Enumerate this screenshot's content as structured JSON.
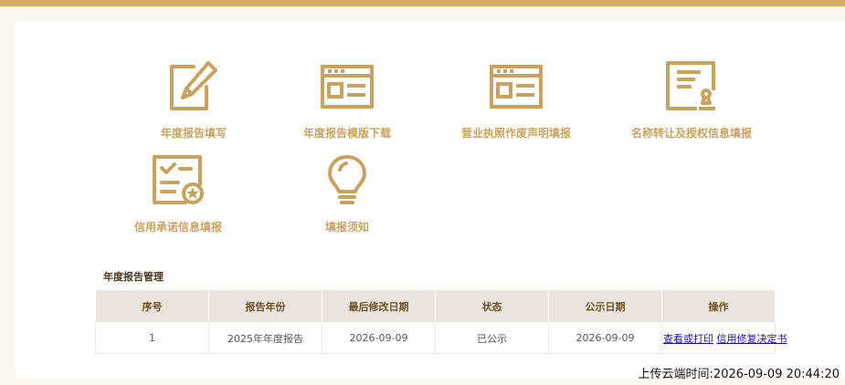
{
  "menu": [
    {
      "label": "年度报告填写",
      "icon": "edit-icon"
    },
    {
      "label": "年度报告模版下载",
      "icon": "template-icon"
    },
    {
      "label": "营业执照作废声明填报",
      "icon": "license-icon"
    },
    {
      "label": "名称转让及授权信息填报",
      "icon": "stamp-document-icon"
    },
    {
      "label": "信用承诺信息填报",
      "icon": "checklist-badge-icon"
    },
    {
      "label": "填报须知",
      "icon": "lightbulb-icon"
    }
  ],
  "section_title": "年度报告管理",
  "table": {
    "headers": [
      "序号",
      "报告年份",
      "最后修改日期",
      "状态",
      "公示日期",
      "操作"
    ],
    "rows": [
      {
        "no": "1",
        "year": "2025年年度报告",
        "modified": "2026-09-09",
        "status": "已公示",
        "publish_date": "2026-09-09",
        "actions": [
          "查看或打印",
          "信用修复决定书"
        ]
      }
    ]
  },
  "upload_time": "上传云端时间:2026-09-09 20:44:20",
  "colors": {
    "accent": "#d4b065",
    "label": "#c8a360",
    "header_bg": "#eae4dd",
    "link": "#1a0dab"
  }
}
